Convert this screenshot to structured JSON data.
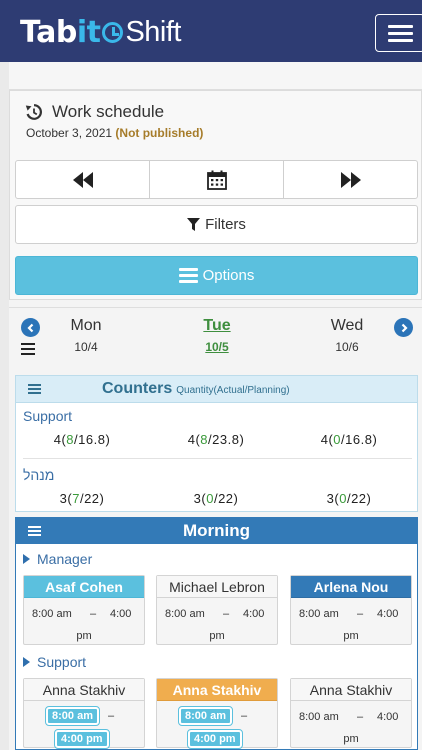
{
  "app": {
    "logo_part1": "Tab",
    "logo_part2": "it",
    "logo_part3": "Shift"
  },
  "schedule": {
    "title": "Work schedule",
    "date": "October 3, 2021",
    "status": "(Not published)"
  },
  "toolbar": {
    "filters_label": "Filters",
    "options_label": "Options"
  },
  "days": [
    {
      "name": "Mon",
      "date": "10/4",
      "active": false
    },
    {
      "name": "Tue",
      "date": "10/5",
      "active": true
    },
    {
      "name": "Wed",
      "date": "10/6",
      "active": false
    }
  ],
  "counters": {
    "title": "Counters",
    "subtitle": "Quantity(Actual/Planning)",
    "rows": [
      {
        "label": "Support",
        "cells": [
          {
            "a": "4",
            "actual": "8",
            "planning": "16.8"
          },
          {
            "a": "4",
            "actual": "8",
            "planning": "23.8"
          },
          {
            "a": "4",
            "actual": "0",
            "planning": "16.8"
          }
        ]
      },
      {
        "label": "מנהל",
        "cells": [
          {
            "a": "3",
            "actual": "7",
            "planning": "22"
          },
          {
            "a": "3",
            "actual": "0",
            "planning": "22"
          },
          {
            "a": "3",
            "actual": "0",
            "planning": "22"
          }
        ]
      }
    ]
  },
  "morning": {
    "title": "Morning",
    "groups": [
      {
        "label": "Manager",
        "shifts": [
          {
            "name": "Asaf Cohen",
            "start": "8:00 am",
            "dash": "–",
            "end": "4:00",
            "pm": "pm",
            "style": "blue"
          },
          {
            "name": "Michael Lebron",
            "start": "8:00 am",
            "dash": "–",
            "end": "4:00",
            "pm": "pm",
            "style": "plain"
          },
          {
            "name": "Arlena Nou",
            "start": "8:00 am",
            "dash": "–",
            "end": "4:00",
            "pm": "pm",
            "style": "navy"
          }
        ]
      },
      {
        "label": "Support",
        "shifts": [
          {
            "name": "Anna Stakhiv",
            "start": "8:00 am",
            "dash": "–",
            "end": "4:00 pm",
            "style": "plain",
            "highlight": true
          },
          {
            "name": "Anna Stakhiv",
            "start": "8:00 am",
            "dash": "–",
            "end": "4:00 pm",
            "style": "orange",
            "highlight": true
          },
          {
            "name": "Anna Stakhiv",
            "start": "8:00 am",
            "dash": "–",
            "end": "4:00",
            "pm": "pm",
            "style": "plain",
            "highlight": false
          }
        ]
      }
    ]
  },
  "colors": {
    "header_bg": "#2e3c73",
    "accent_info": "#5bc0de",
    "primary": "#337ab7",
    "warning": "#f0ad4e",
    "success_text": "#3a9a3a",
    "unpublished_text": "#a67c2a"
  }
}
